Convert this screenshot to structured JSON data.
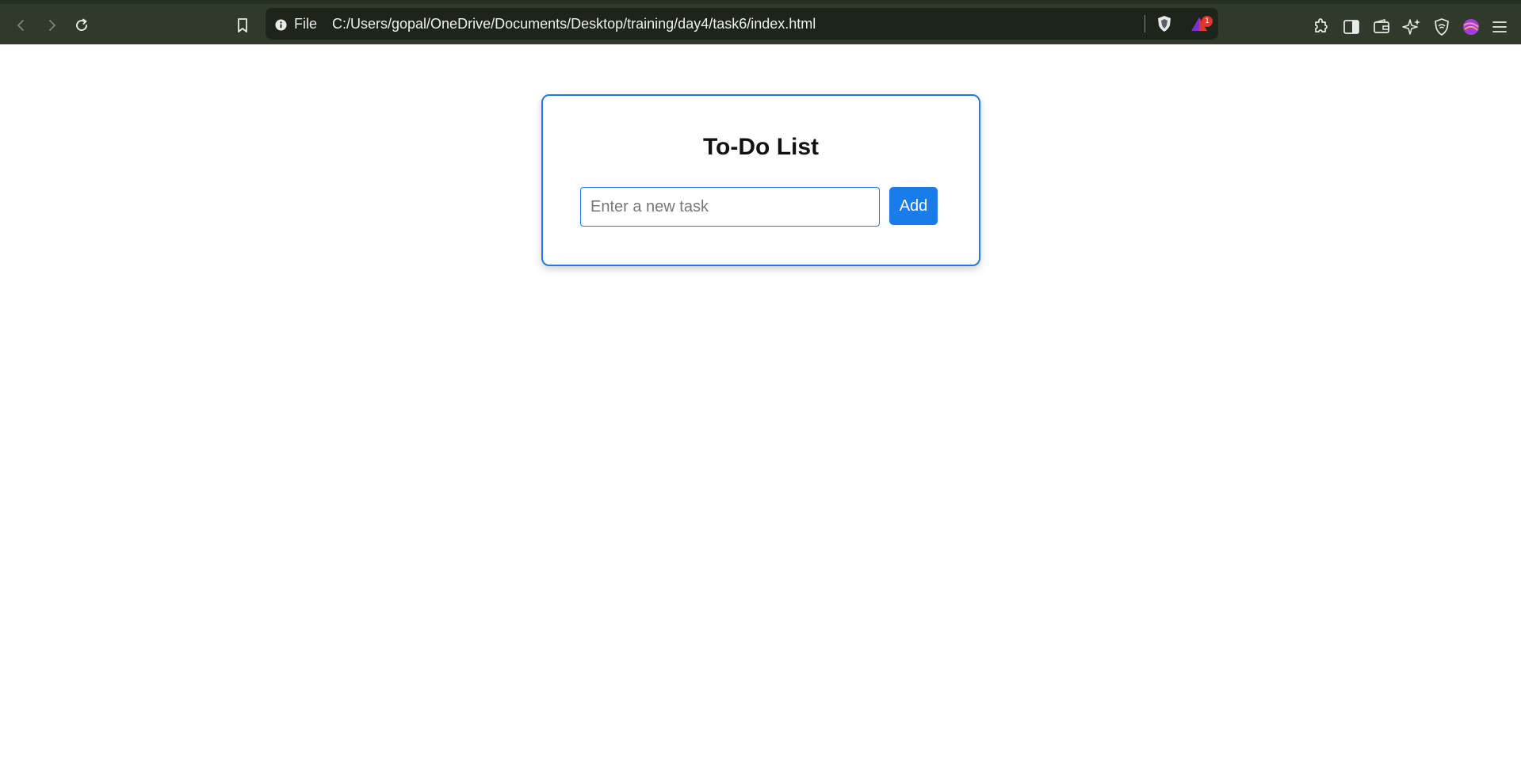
{
  "browser": {
    "file_label": "File",
    "url": "C:/Users/gopal/OneDrive/Documents/Desktop/training/day4/task6/index.html",
    "notification_count": "1",
    "colors": {
      "chrome": "#2f3a2a",
      "urlbar": "#1d2419",
      "badge": "#e2362c"
    },
    "icons": [
      "back-icon",
      "forward-icon",
      "reload-icon",
      "bookmark-icon",
      "info-icon",
      "brave-shield-icon",
      "brave-rewards-icon",
      "extensions-icon",
      "sidebar-icon",
      "wallet-icon",
      "leo-ai-icon",
      "vpn-icon",
      "profile-icon",
      "menu-icon"
    ]
  },
  "todo": {
    "title": "To-Do List",
    "input_placeholder": "Enter a new task",
    "input_value": "",
    "add_label": "Add",
    "accent": "#1a7bea"
  }
}
